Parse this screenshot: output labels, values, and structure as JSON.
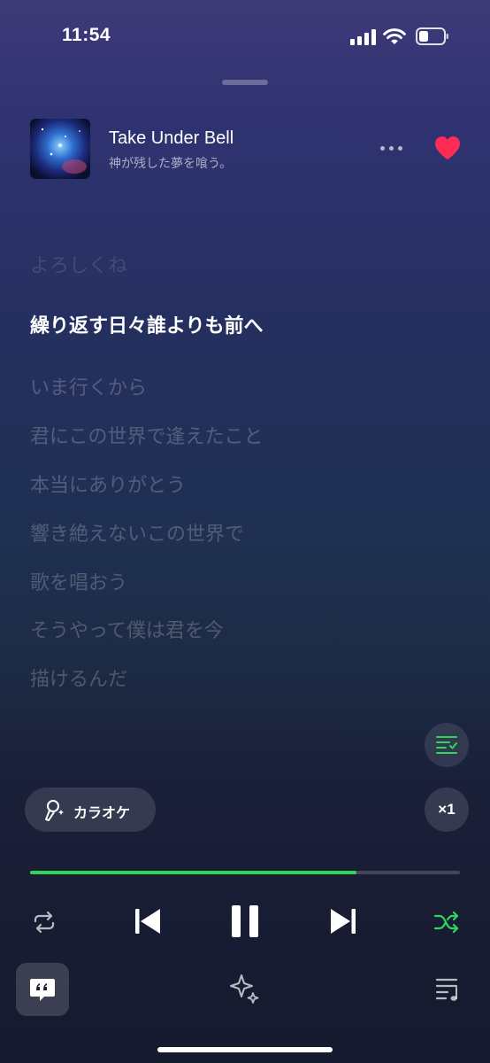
{
  "status": {
    "time": "11:54"
  },
  "track": {
    "title": "Take Under Bell",
    "artist": "神が残した夢を喰う。"
  },
  "lyrics": [
    "よろしくね",
    "繰り返す日々誰よりも前へ",
    "いま行くから",
    "君にこの世界で逢えたこと",
    "本当にありがとう",
    "響き絶えないこの世界で",
    "歌を唱おう",
    "そうやって僕は君を今",
    "描けるんだ"
  ],
  "active_lyric_index": 1,
  "karaoke": {
    "label": "カラオケ"
  },
  "speed": {
    "label": "×1"
  },
  "playback": {
    "progress": 0.76
  },
  "colors": {
    "accent": "#2fd65b",
    "heart": "#ff2d55"
  },
  "icons": {
    "repeat": "repeat-icon",
    "previous": "previous-icon",
    "pause": "pause-icon",
    "next": "next-icon",
    "shuffle": "shuffle-icon",
    "lyrics": "lyrics-quote-icon",
    "sparkle": "sparkle-icon",
    "queue": "queue-icon"
  }
}
